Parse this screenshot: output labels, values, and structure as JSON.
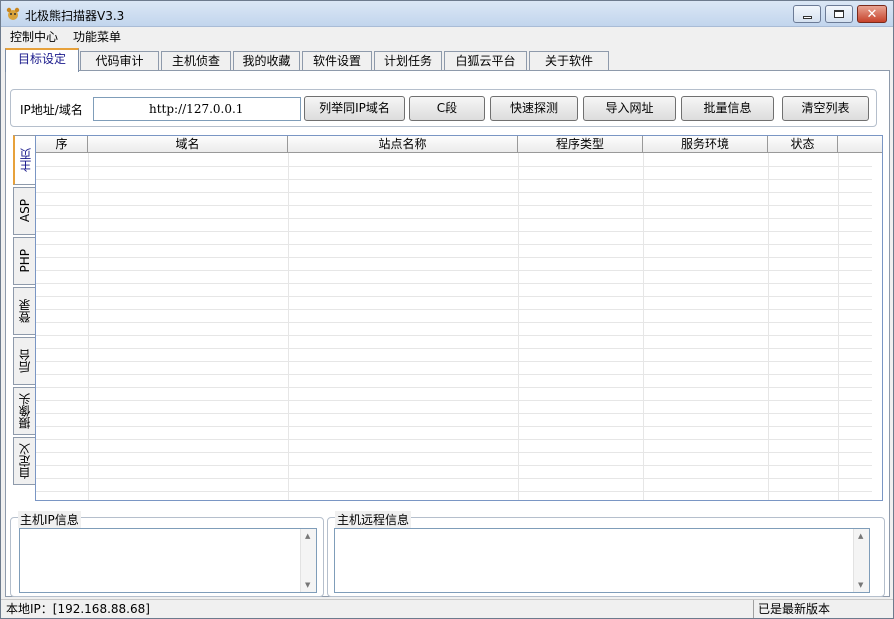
{
  "window": {
    "title": "北极熊扫描器V3.3"
  },
  "menu": [
    "控制中心",
    "功能菜单"
  ],
  "tabs": [
    "目标设定",
    "代码审计",
    "主机侦查",
    "我的收藏",
    "软件设置",
    "计划任务",
    "白狐云平台",
    "关于软件"
  ],
  "target": {
    "label": "IP地址/域名",
    "value": "http://127.0.0.1",
    "buttons": [
      "列举同IP域名",
      "C段",
      "快速探测",
      "导入网址",
      "批量信息",
      "清空列表"
    ]
  },
  "side_tabs": [
    "主页",
    "ASP",
    "PHP",
    "登录",
    "后台",
    "摄像头",
    "自定义"
  ],
  "table": {
    "columns": [
      "序",
      "域名",
      "站点名称",
      "程序类型",
      "服务环境",
      "状态"
    ],
    "rows": []
  },
  "panels": {
    "host_ip_title": "主机IP信息",
    "host_remote_title": "主机远程信息"
  },
  "status": {
    "local_ip": "本地IP：[192.168.88.68]",
    "version": "已是最新版本"
  },
  "colors": {
    "active_tab_accent": "#e7a13b",
    "grid_border": "#7a96c4"
  }
}
